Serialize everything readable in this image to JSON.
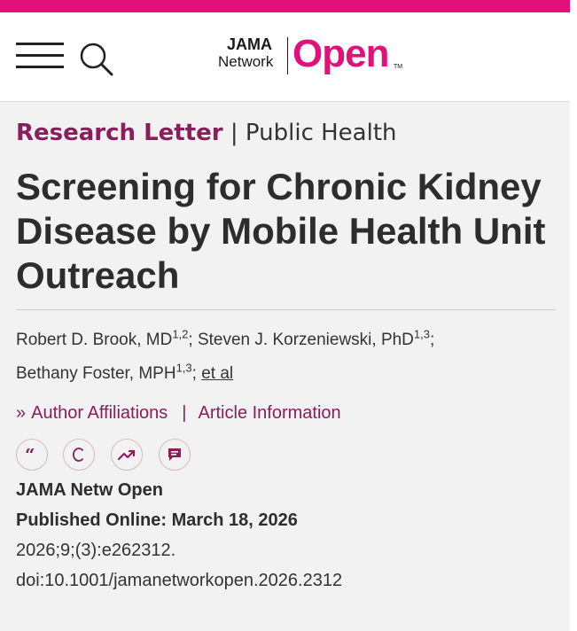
{
  "brand": {
    "logo_line1": "JAMA",
    "logo_line2": "Network",
    "logo_open": "Open",
    "logo_tm": "TM",
    "accent_color": "#e0117a",
    "article_type_color": "#8b1d5c"
  },
  "header": {
    "menu_icon": "hamburger-menu-icon",
    "search_icon": "search-icon"
  },
  "article": {
    "article_type": "Research Letter",
    "separator": "|",
    "section": "Public Health",
    "title": "Screening for Chronic Kidney Disease by Mobile Health Unit Outreach",
    "authors": [
      {
        "name": "Robert D. Brook, MD",
        "sup": "1,2",
        "after": ";"
      },
      {
        "name": "Steven J. Korzeniewski, PhD",
        "sup": "1,3",
        "after": ";"
      },
      {
        "name": "Bethany Foster, MPH",
        "sup": "1,3",
        "after": ";"
      }
    ],
    "et_al": "et al",
    "links": {
      "affiliations_chevron": "»",
      "affiliations": "Author Affiliations",
      "separator": "|",
      "article_info": "Article Information"
    },
    "action_icons": [
      "quote-icon",
      "crossref-icon",
      "metrics-icon",
      "comment-icon"
    ],
    "journal": "JAMA Netw Open",
    "published": "Published Online: March 18, 2026",
    "citation": "2026;9;(3):e262312.",
    "doi": "doi:10.1001/jamanetworkopen.2026.2312"
  }
}
